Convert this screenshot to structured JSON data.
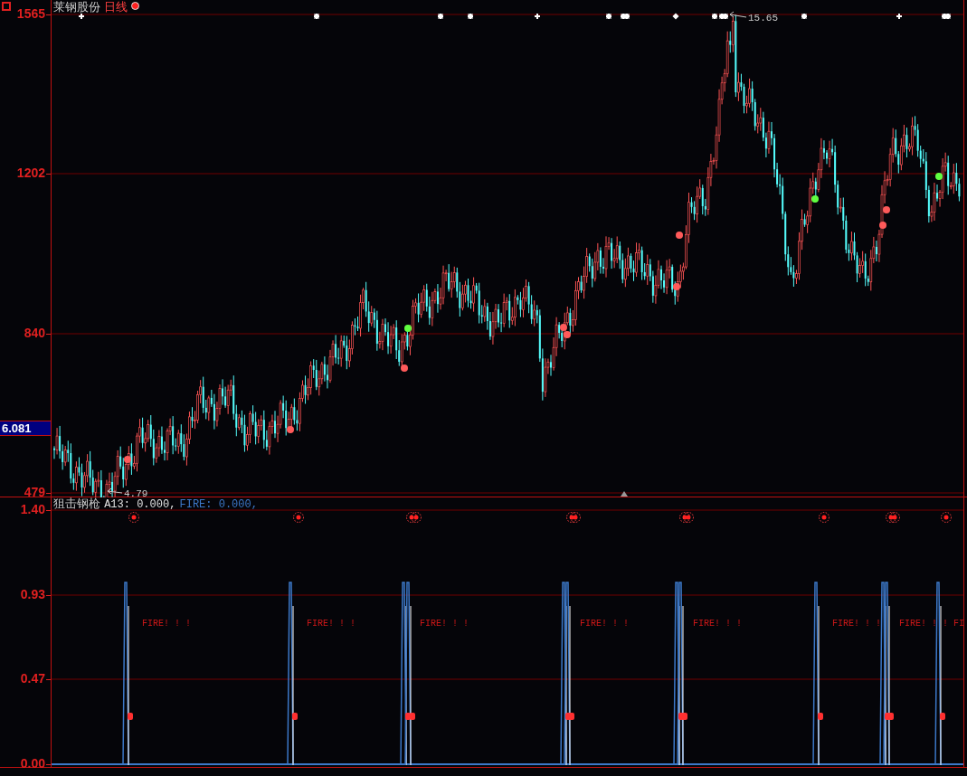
{
  "stock": {
    "name": "莱钢股份",
    "period": "日线"
  },
  "price_axis": {
    "labels": [
      "1565",
      "1202",
      "840",
      "479"
    ],
    "current_price": "6.081"
  },
  "price_chart": {
    "high_label": "15.65",
    "low_label": "4.79"
  },
  "indicator": {
    "name": "狙击钢枪",
    "values": [
      {
        "kind": "a13",
        "text": "A13: 0.000,"
      },
      {
        "kind": "fire",
        "text": "FIRE: 0.000,"
      }
    ],
    "axis_labels": [
      "1.40",
      "0.93",
      "0.47",
      "0.00"
    ],
    "signal_labels": [
      "FIRE! ! !",
      "FIRE! ! !",
      "FIRE! ! !",
      "FIRE! ! !",
      "FIRE! ! !",
      "FIRE! ! !",
      "FIRE! ! !",
      "FI"
    ]
  }
}
